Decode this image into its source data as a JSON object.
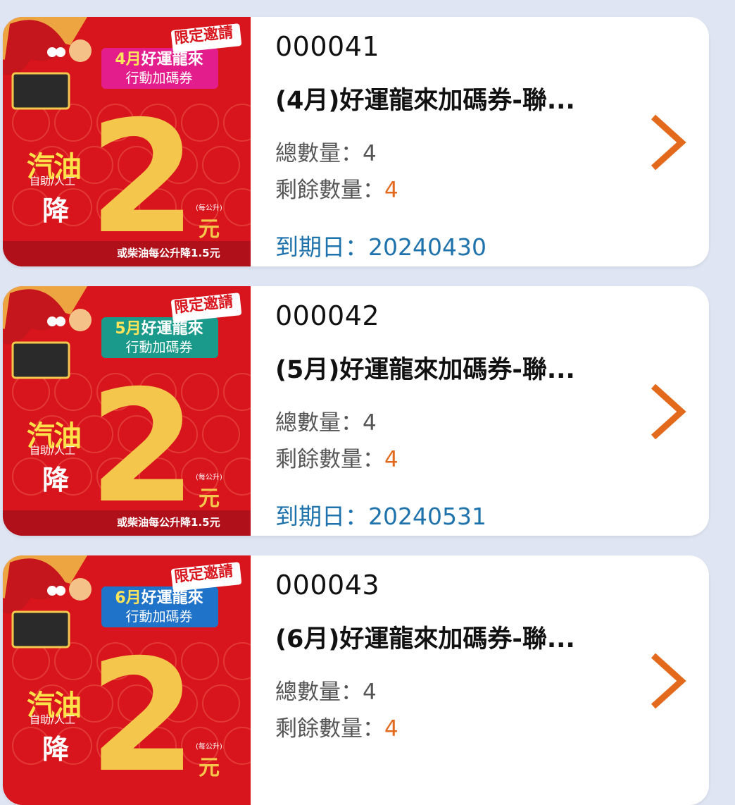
{
  "coupons": [
    {
      "code": "000041",
      "title": "(4月)好運龍來加碼券-聯...",
      "total_label": "總數量：",
      "total_value": "4",
      "remaining_label": "剩餘數量：",
      "remaining_value": "4",
      "expiry_label": "到期日：",
      "expiry_value": "20240430",
      "banner": {
        "tag": "限定邀請",
        "month": "4月",
        "title_rest": "好運龍來",
        "subtitle": "行動加碼券",
        "fuel": "汽油",
        "service": "自助/人工",
        "reduce": "降",
        "amount": "2",
        "per_liter": "(每公升)",
        "unit": "元",
        "diesel_note": "或柴油每公升降1.5元",
        "banner_color": "#e31e8c"
      }
    },
    {
      "code": "000042",
      "title": "(5月)好運龍來加碼券-聯...",
      "total_label": "總數量：",
      "total_value": "4",
      "remaining_label": "剩餘數量：",
      "remaining_value": "4",
      "expiry_label": "到期日：",
      "expiry_value": "20240531",
      "banner": {
        "tag": "限定邀請",
        "month": "5月",
        "title_rest": "好運龍來",
        "subtitle": "行動加碼券",
        "fuel": "汽油",
        "service": "自助/人工",
        "reduce": "降",
        "amount": "2",
        "per_liter": "(每公升)",
        "unit": "元",
        "diesel_note": "或柴油每公升降1.5元",
        "banner_color": "#1a9a8a"
      }
    },
    {
      "code": "000043",
      "title": "(6月)好運龍來加碼券-聯...",
      "total_label": "總數量：",
      "total_value": "4",
      "remaining_label": "剩餘數量：",
      "remaining_value": "4",
      "expiry_label": "",
      "expiry_value": "",
      "banner": {
        "tag": "限定邀請",
        "month": "6月",
        "title_rest": "好運龍來",
        "subtitle": "行動加碼券",
        "fuel": "汽油",
        "service": "自助/人工",
        "reduce": "降",
        "amount": "2",
        "per_liter": "(每公升)",
        "unit": "元",
        "diesel_note": "",
        "banner_color": "#1f73c8"
      }
    }
  ],
  "icons": {
    "chevron": "chevron-right-icon",
    "mascot": "dragon-mascot-icon"
  },
  "colors": {
    "background": "#dfe5f3",
    "accent_orange": "#e36a1c",
    "expiry_blue": "#1f73ad",
    "promo_red": "#d8141c",
    "promo_gold": "#f4c64c"
  }
}
